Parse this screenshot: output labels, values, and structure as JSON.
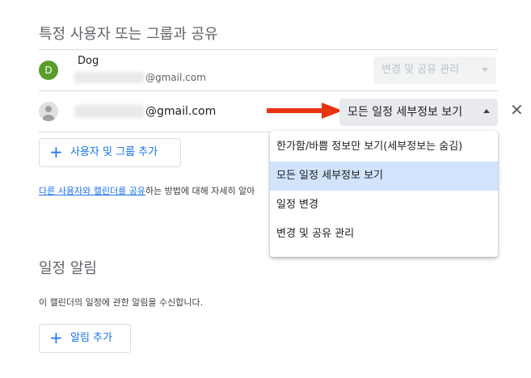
{
  "sharing": {
    "title": "특정 사용자 또는 그룹과 공유",
    "users": [
      {
        "avatar_letter": "D",
        "name": "Dog",
        "email_suffix": "@gmail.com",
        "permission": "변경 및 공유 관리"
      },
      {
        "email_suffix": "@gmail.com",
        "permission": "모든 일정 세부정보 보기"
      }
    ],
    "add_button_label": "사용자 및 그룹 추가",
    "help_link": "다른 사용자와 캘린더를 공유",
    "help_text_rest": "하는 방법에 대해 자세히 알아"
  },
  "permission_menu": {
    "options": [
      "한가함/바쁨 정보만 보기(세부정보는 숨김)",
      "모든 일정 세부정보 보기",
      "일정 변경",
      "변경 및 공유 관리"
    ],
    "selected_index": 1
  },
  "notifications": {
    "title": "일정 알림",
    "description": "이 캘린더의 일정에 관한 알림을 수신합니다.",
    "add_button_label": "알림 추가"
  },
  "colors": {
    "accent": "#1a73e8",
    "arrow": "#e8340f",
    "selected_bg": "#d2e3fc"
  }
}
